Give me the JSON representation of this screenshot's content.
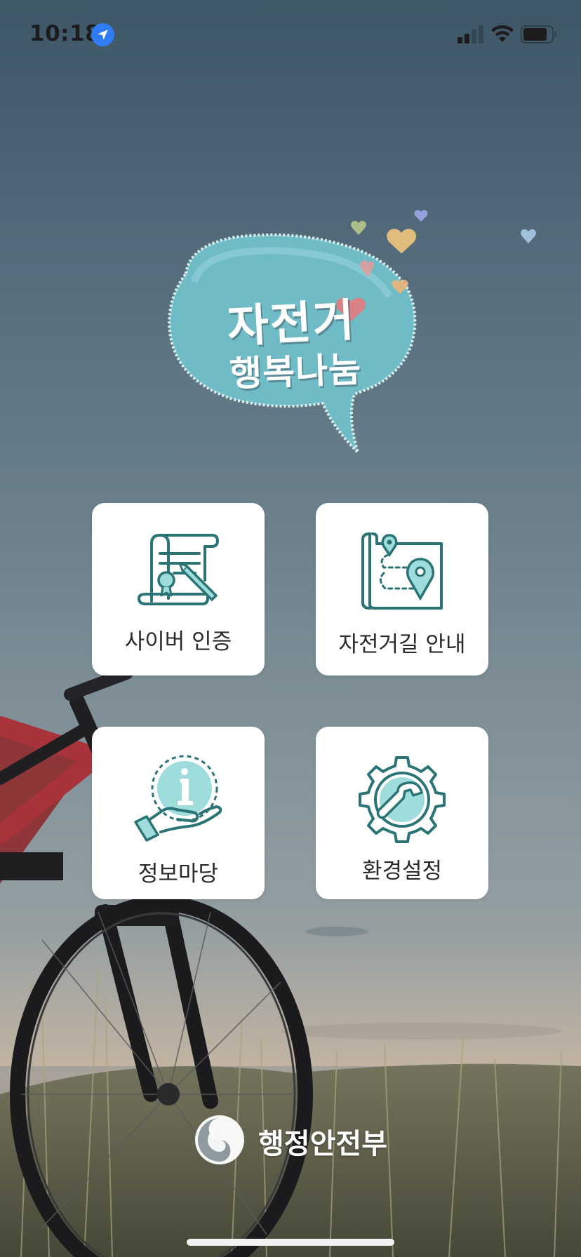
{
  "status_bar": {
    "time": "10:18",
    "icons": [
      "location-arrow-icon",
      "cellular-signal-icon",
      "wifi-icon",
      "battery-icon"
    ]
  },
  "logo": {
    "line1": "자전거",
    "line2": "행복나눔",
    "bubble_color": "#6fbcc7"
  },
  "menu": {
    "items": [
      {
        "id": "cyber-cert",
        "label": "사이버 인증",
        "icon": "certificate-scroll-icon"
      },
      {
        "id": "bike-route",
        "label": "자전거길 안내",
        "icon": "route-map-icon"
      },
      {
        "id": "info",
        "label": "정보마당",
        "icon": "info-hand-icon"
      },
      {
        "id": "settings",
        "label": "환경설정",
        "icon": "gear-wrench-icon"
      }
    ],
    "icon_colors": {
      "stroke": "#2a7475",
      "fill": "#9fdcdc"
    }
  },
  "footer": {
    "ministry_name": "행정안전부",
    "emblem": "ministry-emblem-icon"
  }
}
